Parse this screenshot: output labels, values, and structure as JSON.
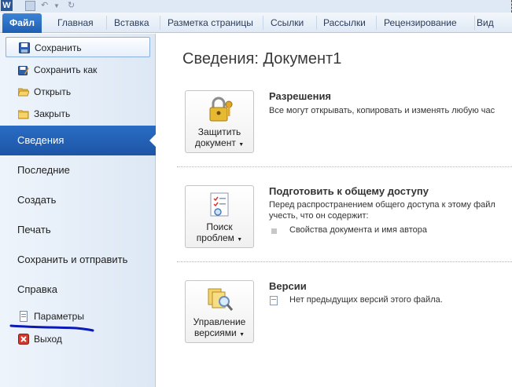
{
  "qat": {
    "app_icon_letter": "W"
  },
  "tabs": [
    {
      "label": "Файл"
    },
    {
      "label": "Главная"
    },
    {
      "label": "Вставка"
    },
    {
      "label": "Разметка страницы"
    },
    {
      "label": "Ссылки"
    },
    {
      "label": "Рассылки"
    },
    {
      "label": "Рецензирование"
    },
    {
      "label": "Вид"
    }
  ],
  "nav": {
    "save": "Сохранить",
    "save_as": "Сохранить как",
    "open": "Открыть",
    "close": "Закрыть",
    "info": "Сведения",
    "recent": "Последние",
    "new": "Создать",
    "print": "Печать",
    "save_send": "Сохранить и отправить",
    "help": "Справка",
    "options": "Параметры",
    "exit": "Выход"
  },
  "main": {
    "title": "Сведения: Документ1",
    "permissions": {
      "button_line1": "Защитить",
      "button_line2": "документ",
      "heading": "Разрешения",
      "text": "Все могут открывать, копировать и изменять любую час"
    },
    "prepare": {
      "button_line1": "Поиск",
      "button_line2": "проблем",
      "heading": "Подготовить к общему доступу",
      "text1": "Перед распространением общего доступа к этому файл",
      "text2": "учесть, что он содержит:",
      "bullet": "Свойства документа и имя автора"
    },
    "versions": {
      "button_line1": "Управление",
      "button_line2": "версиями",
      "heading": "Версии",
      "text": "Нет предыдущих версий этого файла."
    }
  },
  "colors": {
    "file_tab": "#1f5fb3",
    "nav_active": "#2a6cc4",
    "annotation_underline": "#0a1ab8"
  },
  "icons": {
    "save": "floppy-disk-icon",
    "save_as": "floppy-disk-pencil-icon",
    "open": "open-folder-icon",
    "close": "folder-close-icon",
    "options": "document-options-icon",
    "exit": "red-x-icon",
    "protect": "padlock-key-icon",
    "inspect": "checklist-inspect-icon",
    "versions": "versions-magnifier-icon"
  }
}
